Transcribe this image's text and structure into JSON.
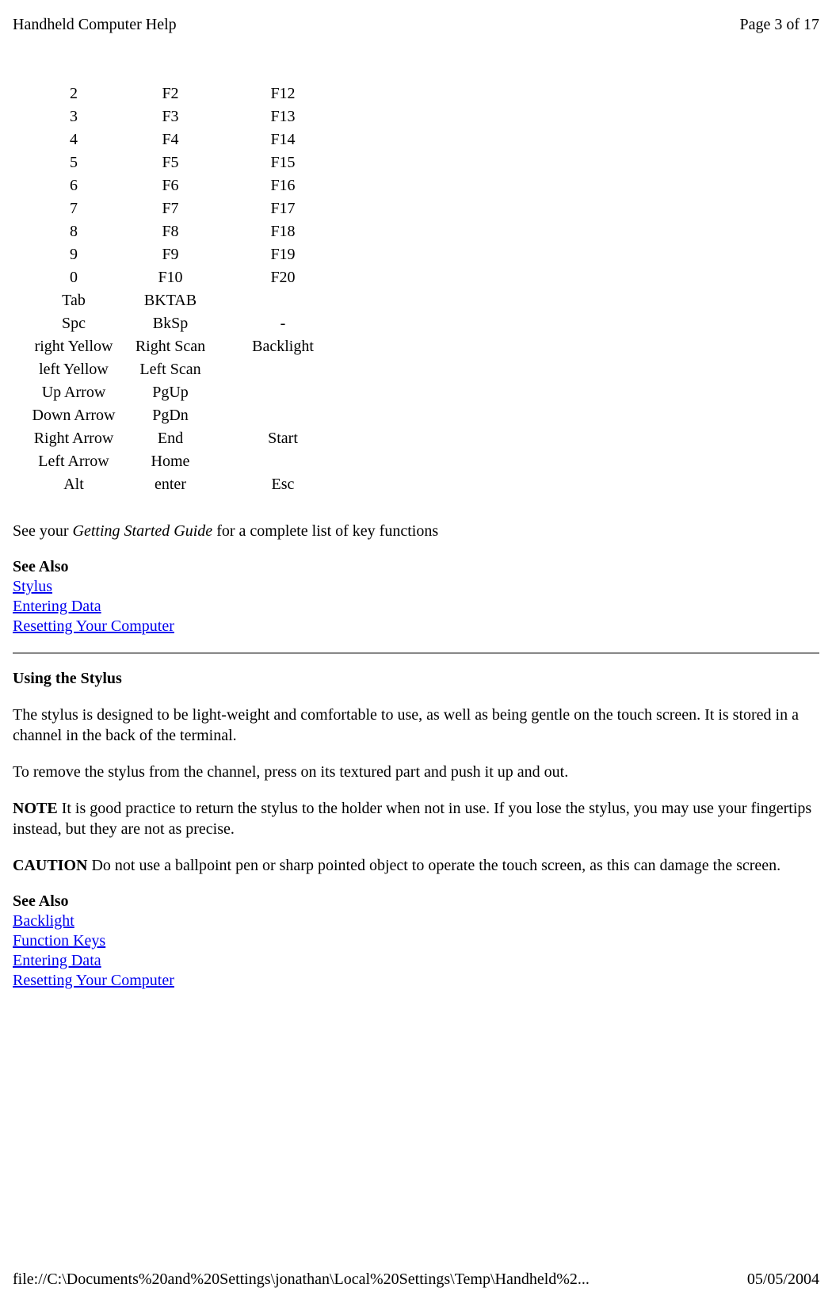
{
  "header": {
    "title": "Handheld Computer Help",
    "page": "Page 3 of 17"
  },
  "key_rows": [
    {
      "c1": "2",
      "c2": "F2",
      "c3": "F12"
    },
    {
      "c1": "3",
      "c2": "F3",
      "c3": "F13"
    },
    {
      "c1": "4",
      "c2": "F4",
      "c3": "F14"
    },
    {
      "c1": "5",
      "c2": "F5",
      "c3": "F15"
    },
    {
      "c1": "6",
      "c2": "F6",
      "c3": "F16"
    },
    {
      "c1": "7",
      "c2": "F7",
      "c3": "F17"
    },
    {
      "c1": "8",
      "c2": "F8",
      "c3": "F18"
    },
    {
      "c1": "9",
      "c2": "F9",
      "c3": "F19"
    },
    {
      "c1": "0",
      "c2": "F10",
      "c3": "F20"
    },
    {
      "c1": "Tab",
      "c2": "BKTAB",
      "c3": ""
    },
    {
      "c1": "Spc",
      "c2": "BkSp",
      "c3": "-"
    },
    {
      "c1": "right Yellow",
      "c2": "Right Scan",
      "c3": "Backlight"
    },
    {
      "c1": "left Yellow",
      "c2": "Left Scan",
      "c3": ""
    },
    {
      "c1": "Up Arrow",
      "c2": "PgUp",
      "c3": ""
    },
    {
      "c1": "Down Arrow",
      "c2": "PgDn",
      "c3": ""
    },
    {
      "c1": "Right Arrow",
      "c2": "End",
      "c3": "Start"
    },
    {
      "c1": "Left Arrow",
      "c2": "Home",
      "c3": ""
    },
    {
      "c1": "Alt",
      "c2": "enter",
      "c3": "Esc"
    }
  ],
  "para1_pre": "See your ",
  "para1_italic": "Getting Started Guide",
  "para1_post": " for a complete list of key functions",
  "see_also": "See Also",
  "links1": [
    "Stylus",
    "Entering Data",
    "Resetting Your Computer"
  ],
  "section2_heading": "Using the Stylus",
  "section2_p1": "The stylus is designed to be light-weight and comfortable to use, as well as being gentle on the touch screen. It is stored in a channel in the back of the terminal.",
  "section2_p2": "To remove the stylus from the channel, press on its textured part and push it up and out.",
  "note_label": "NOTE",
  "note_text": " It is good practice to return the stylus to the holder when not in use. If you lose the stylus, you may use your fingertips instead, but they are not as precise.",
  "caution_label": "CAUTION",
  "caution_text": " Do not use a ballpoint pen or sharp pointed object to operate the touch screen, as this can damage the screen.",
  "links2": [
    "Backlight",
    "Function Keys",
    "Entering Data",
    "Resetting Your Computer"
  ],
  "footer": {
    "path": "file://C:\\Documents%20and%20Settings\\jonathan\\Local%20Settings\\Temp\\Handheld%2...",
    "date": "05/05/2004"
  }
}
